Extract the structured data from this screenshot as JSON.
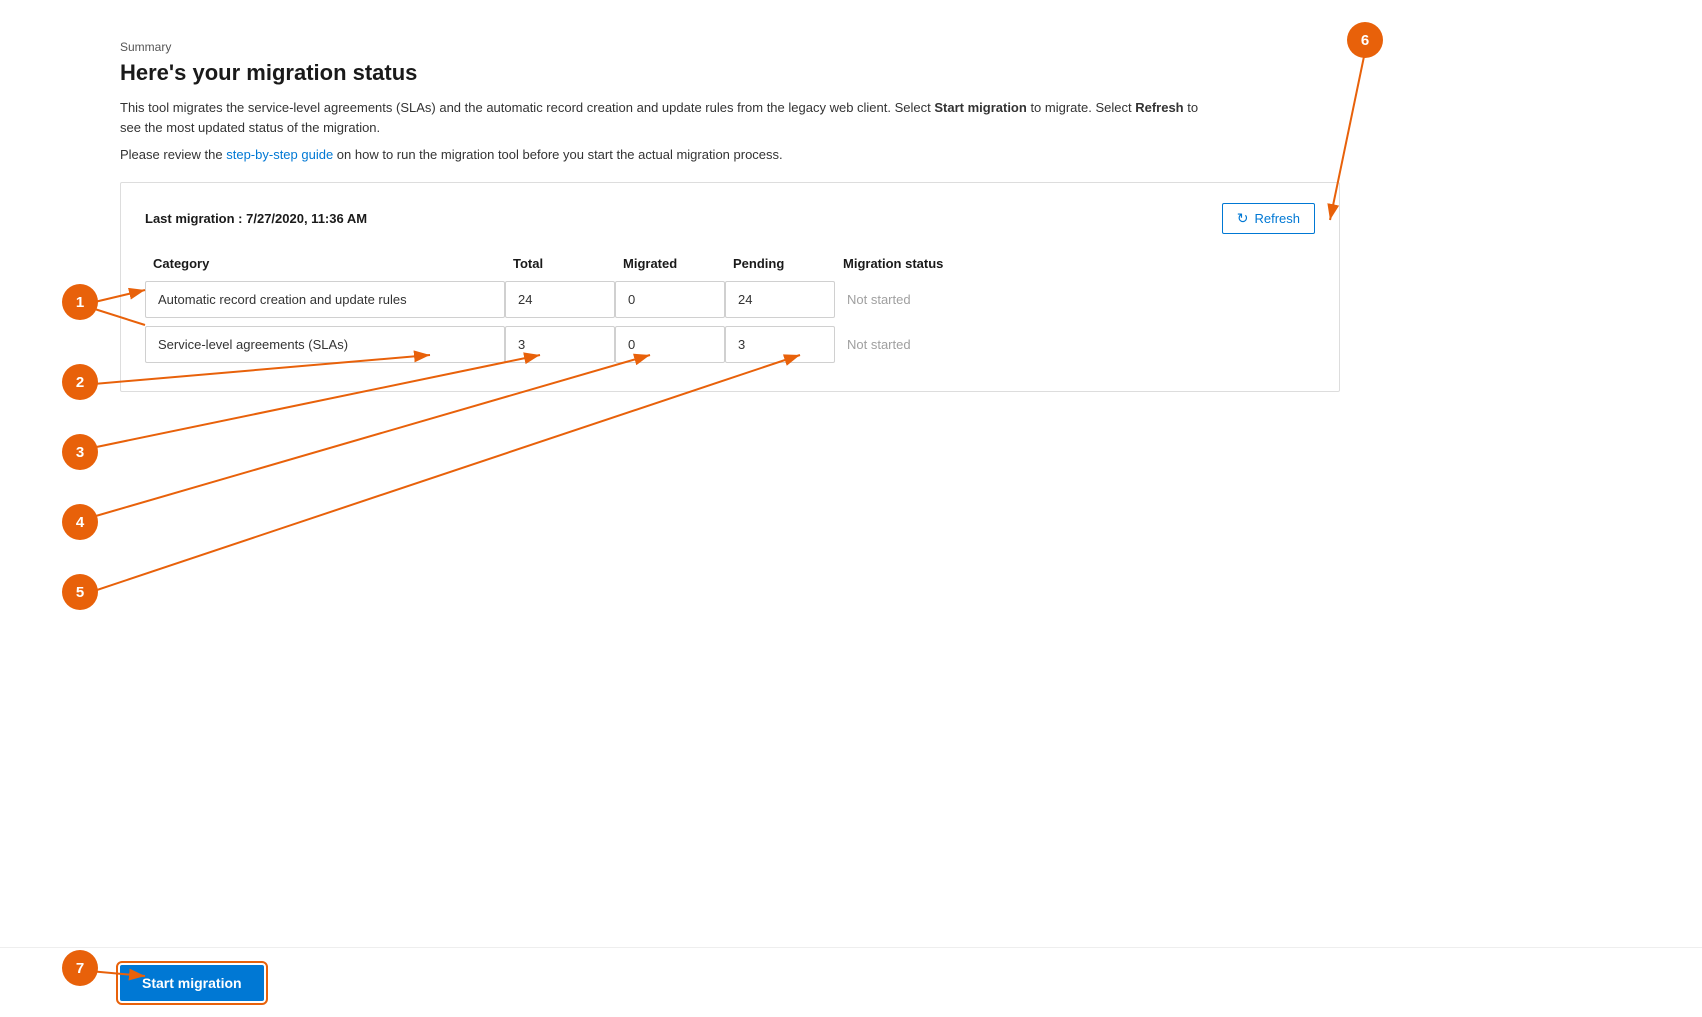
{
  "header": {
    "summary_label": "Summary",
    "page_title": "Here's your migration status",
    "description": "This tool migrates the service-level agreements (SLAs) and the automatic record creation and update rules from the legacy web client. Select ",
    "desc_bold1": "Start migration",
    "desc_middle": " to migrate. Select ",
    "desc_bold2": "Refresh",
    "desc_end": " to see the most updated status of the migration.",
    "guide_prefix": "Please review the ",
    "guide_link_text": "step-by-step guide",
    "guide_suffix": " on how to run the migration tool before you start the actual migration process."
  },
  "migration_card": {
    "last_migration_label": "Last migration : 7/27/2020, 11:36 AM",
    "refresh_button_label": "Refresh"
  },
  "table": {
    "columns": [
      "Category",
      "Total",
      "Migrated",
      "Pending",
      "Migration status"
    ],
    "rows": [
      {
        "category": "Automatic record creation and update rules",
        "total": "24",
        "migrated": "0",
        "pending": "24",
        "status": "Not started"
      },
      {
        "category": "Service-level agreements (SLAs)",
        "total": "3",
        "migrated": "0",
        "pending": "3",
        "status": "Not started"
      }
    ]
  },
  "annotations": [
    {
      "id": "1",
      "label": "1"
    },
    {
      "id": "2",
      "label": "2"
    },
    {
      "id": "3",
      "label": "3"
    },
    {
      "id": "4",
      "label": "4"
    },
    {
      "id": "5",
      "label": "5"
    },
    {
      "id": "6",
      "label": "6"
    },
    {
      "id": "7",
      "label": "7"
    }
  ],
  "footer": {
    "start_migration_label": "Start migration"
  }
}
